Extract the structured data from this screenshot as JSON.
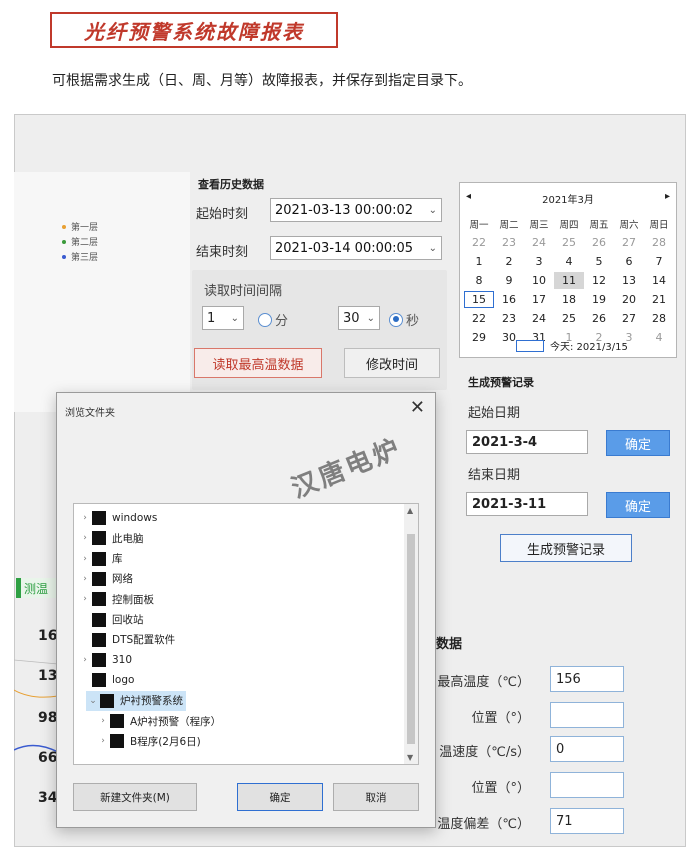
{
  "header": {
    "banner_title": "光纤预警系统故障报表",
    "intro": "可根据需求生成（日、周、月等）故障报表，并保存到指定目录下。"
  },
  "legend": [
    "第一层",
    "第二层",
    "第三层"
  ],
  "legend_colors": [
    "#e8a033",
    "#3a9a3a",
    "#3a5bd0"
  ],
  "history": {
    "title": "查看历史数据",
    "start_label": "起始时刻",
    "start_value": "2021-03-13 00:00:02",
    "end_label": "结束时刻",
    "end_value": "2021-03-14 00:00:05",
    "interval_label": "读取时间间隔",
    "minute_value": "1",
    "minute_unit": "分",
    "second_value": "30",
    "second_unit": "秒",
    "read_button": "读取最高温数据",
    "modify_button": "修改时间"
  },
  "calendar": {
    "month_label": "2021年3月",
    "prev": "◂",
    "next": "▸",
    "weekdays": [
      "周一",
      "周二",
      "周三",
      "周四",
      "周五",
      "周六",
      "周日"
    ],
    "weeks": [
      [
        "22",
        "23",
        "24",
        "25",
        "26",
        "27",
        "28"
      ],
      [
        "1",
        "2",
        "3",
        "4",
        "5",
        "6",
        "7"
      ],
      [
        "8",
        "9",
        "10",
        "11",
        "12",
        "13",
        "14"
      ],
      [
        "15",
        "16",
        "17",
        "18",
        "19",
        "20",
        "21"
      ],
      [
        "22",
        "23",
        "24",
        "25",
        "26",
        "27",
        "28"
      ],
      [
        "29",
        "30",
        "31",
        "1",
        "2",
        "3",
        "4"
      ]
    ],
    "today_label": "今天: 2021/3/15"
  },
  "records": {
    "title": "生成预警记录",
    "start_label": "起始日期",
    "start_value": "2021-3-4",
    "end_label": "结束日期",
    "end_value": "2021-3-11",
    "confirm_label": "确定",
    "generate_button": "生成预警记录"
  },
  "data_section": {
    "title_fragment": "数据",
    "rows": [
      {
        "label": "最高温度（℃）",
        "value": "156"
      },
      {
        "label": "位置（°）",
        "value": ""
      },
      {
        "label": "温速度（℃/s）",
        "value": "0"
      },
      {
        "label": "位置（°）",
        "value": ""
      },
      {
        "label": "温度偏差（℃）",
        "value": "71"
      }
    ]
  },
  "left_partial": {
    "tag": "测温",
    "numbers": [
      "16",
      "13",
      "98",
      "66",
      "34"
    ]
  },
  "dialog": {
    "title": "浏览文件夹",
    "close": "✕",
    "tree": [
      {
        "label": "windows",
        "level": 0,
        "expander": "›",
        "highlight": false
      },
      {
        "label": "此电脑",
        "level": 0,
        "expander": "›",
        "highlight": false
      },
      {
        "label": "库",
        "level": 0,
        "expander": "›",
        "highlight": false
      },
      {
        "label": "网络",
        "level": 0,
        "expander": "›",
        "highlight": false
      },
      {
        "label": "控制面板",
        "level": 0,
        "expander": "›",
        "highlight": false
      },
      {
        "label": "回收站",
        "level": 0,
        "expander": "",
        "highlight": false
      },
      {
        "label": "DTS配置软件",
        "level": 0,
        "expander": "",
        "highlight": false
      },
      {
        "label": "310",
        "level": 0,
        "expander": "›",
        "highlight": false
      },
      {
        "label": "logo",
        "level": 0,
        "expander": "",
        "highlight": false
      },
      {
        "label": "炉衬预警系统",
        "level": 0,
        "expander": "⌄",
        "highlight": true
      },
      {
        "label": "A炉衬预警（程序）",
        "level": 1,
        "expander": "›",
        "highlight": false
      },
      {
        "label": "B程序(2月6日)",
        "level": 1,
        "expander": "›",
        "highlight": false
      }
    ],
    "new_folder": "新建文件夹(M)",
    "ok": "确定",
    "cancel": "取消"
  },
  "watermark": "汉唐电炉"
}
